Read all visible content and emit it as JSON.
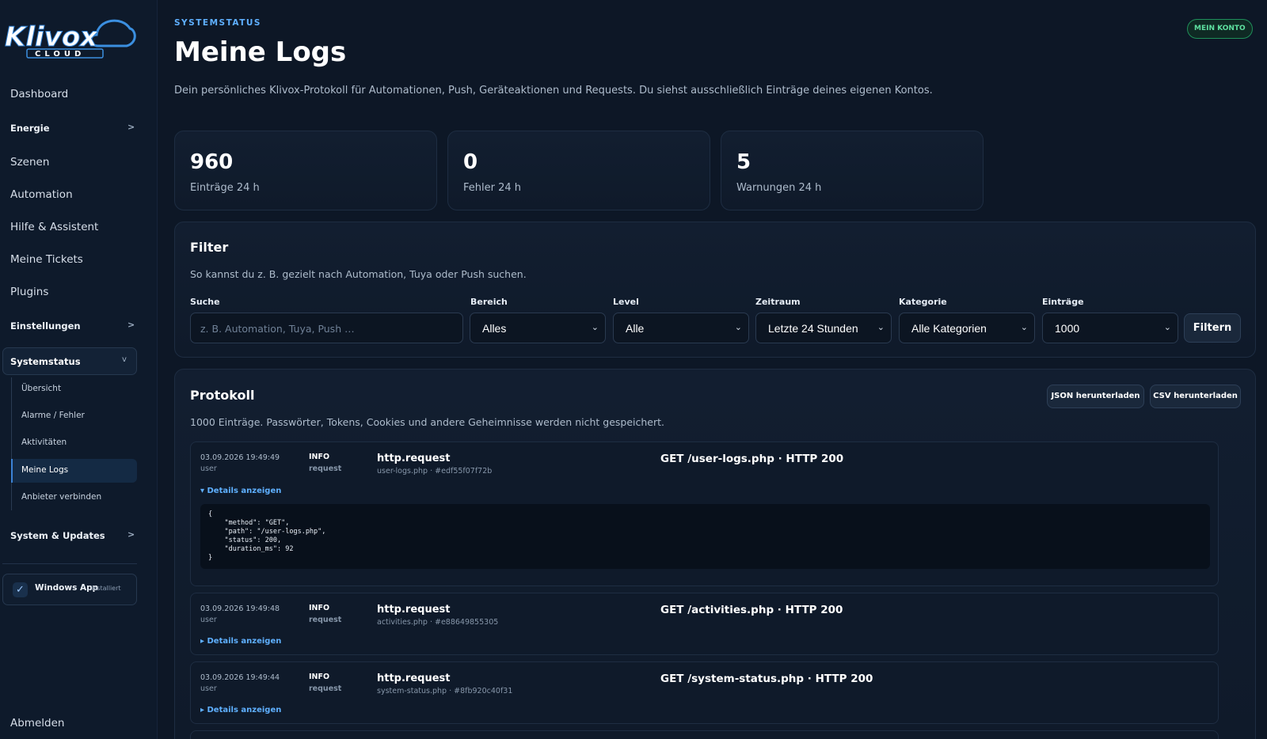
{
  "brand": {
    "name": "Klivox",
    "sub": "CLOUD"
  },
  "sidebar": {
    "items": [
      {
        "label": "Dashboard"
      },
      {
        "label": "Energie",
        "chevron": ">"
      },
      {
        "label": "Szenen"
      },
      {
        "label": "Automation"
      },
      {
        "label": "Hilfe & Assistent"
      },
      {
        "label": "Meine Tickets"
      },
      {
        "label": "Plugins"
      },
      {
        "label": "Einstellungen",
        "chevron": ">"
      },
      {
        "label": "Systemstatus",
        "chevron": "v"
      },
      {
        "label": "System & Updates",
        "chevron": ">"
      }
    ],
    "sub": [
      {
        "label": "Übersicht"
      },
      {
        "label": "Alarme / Fehler"
      },
      {
        "label": "Aktivitäten"
      },
      {
        "label": "Meine Logs"
      },
      {
        "label": "Anbieter verbinden"
      }
    ],
    "windows_app": {
      "title": "Windows App",
      "status": "installiert",
      "check": "✓"
    },
    "logout": "Abmelden"
  },
  "header": {
    "eyebrow": "SYSTEMSTATUS",
    "title": "Meine Logs",
    "lede": "Dein persönliches Klivox-Protokoll für Automationen, Push, Geräteaktionen und Requests. Du siehst ausschließlich Einträge deines eigenen Kontos.",
    "account": "MEIN KONTO"
  },
  "stats": [
    {
      "value": "960",
      "label": "Einträge 24 h"
    },
    {
      "value": "0",
      "label": "Fehler 24 h"
    },
    {
      "value": "5",
      "label": "Warnungen 24 h"
    }
  ],
  "filter": {
    "title": "Filter",
    "hint": "So kannst du z. B. gezielt nach Automation, Tuya oder Push suchen.",
    "search": {
      "label": "Suche",
      "placeholder": "z. B. Automation, Tuya, Push …"
    },
    "bereich": {
      "label": "Bereich",
      "value": "Alles"
    },
    "level": {
      "label": "Level",
      "value": "Alle"
    },
    "zeitraum": {
      "label": "Zeitraum",
      "value": "Letzte 24 Stunden"
    },
    "kategorie": {
      "label": "Kategorie",
      "value": "Alle Kategorien"
    },
    "eintraege": {
      "label": "Einträge",
      "value": "1000"
    },
    "submit": "Filtern"
  },
  "protokoll": {
    "title": "Protokoll",
    "hint": "1000 Einträge. Passwörter, Tokens, Cookies und andere Geheimnisse werden nicht gespeichert.",
    "json_btn": "JSON herunterladen",
    "csv_btn": "CSV herunterladen",
    "entries": [
      {
        "ts": "03.09.2026 19:49:49",
        "who": "user",
        "level": "INFO",
        "kind": "request",
        "event": "http.request",
        "source": "user-logs.php · #edf55f07f72b",
        "message": "GET /user-logs.php · HTTP 200",
        "details_label": "▾ Details anzeigen",
        "details": "{\n    \"method\": \"GET\",\n    \"path\": \"/user-logs.php\",\n    \"status\": 200,\n    \"duration_ms\": 92\n}"
      },
      {
        "ts": "03.09.2026 19:49:48",
        "who": "user",
        "level": "INFO",
        "kind": "request",
        "event": "http.request",
        "source": "activities.php · #e88649855305",
        "message": "GET /activities.php · HTTP 200",
        "details_label": "▸ Details anzeigen"
      },
      {
        "ts": "03.09.2026 19:49:44",
        "who": "user",
        "level": "INFO",
        "kind": "request",
        "event": "http.request",
        "source": "system-status.php · #8fb920c40f31",
        "message": "GET /system-status.php · HTTP 200",
        "details_label": "▸ Details anzeigen"
      }
    ]
  },
  "colors": {
    "background": "#0d1726",
    "accent": "#5fb0ff",
    "success": "#5ee0a0"
  }
}
